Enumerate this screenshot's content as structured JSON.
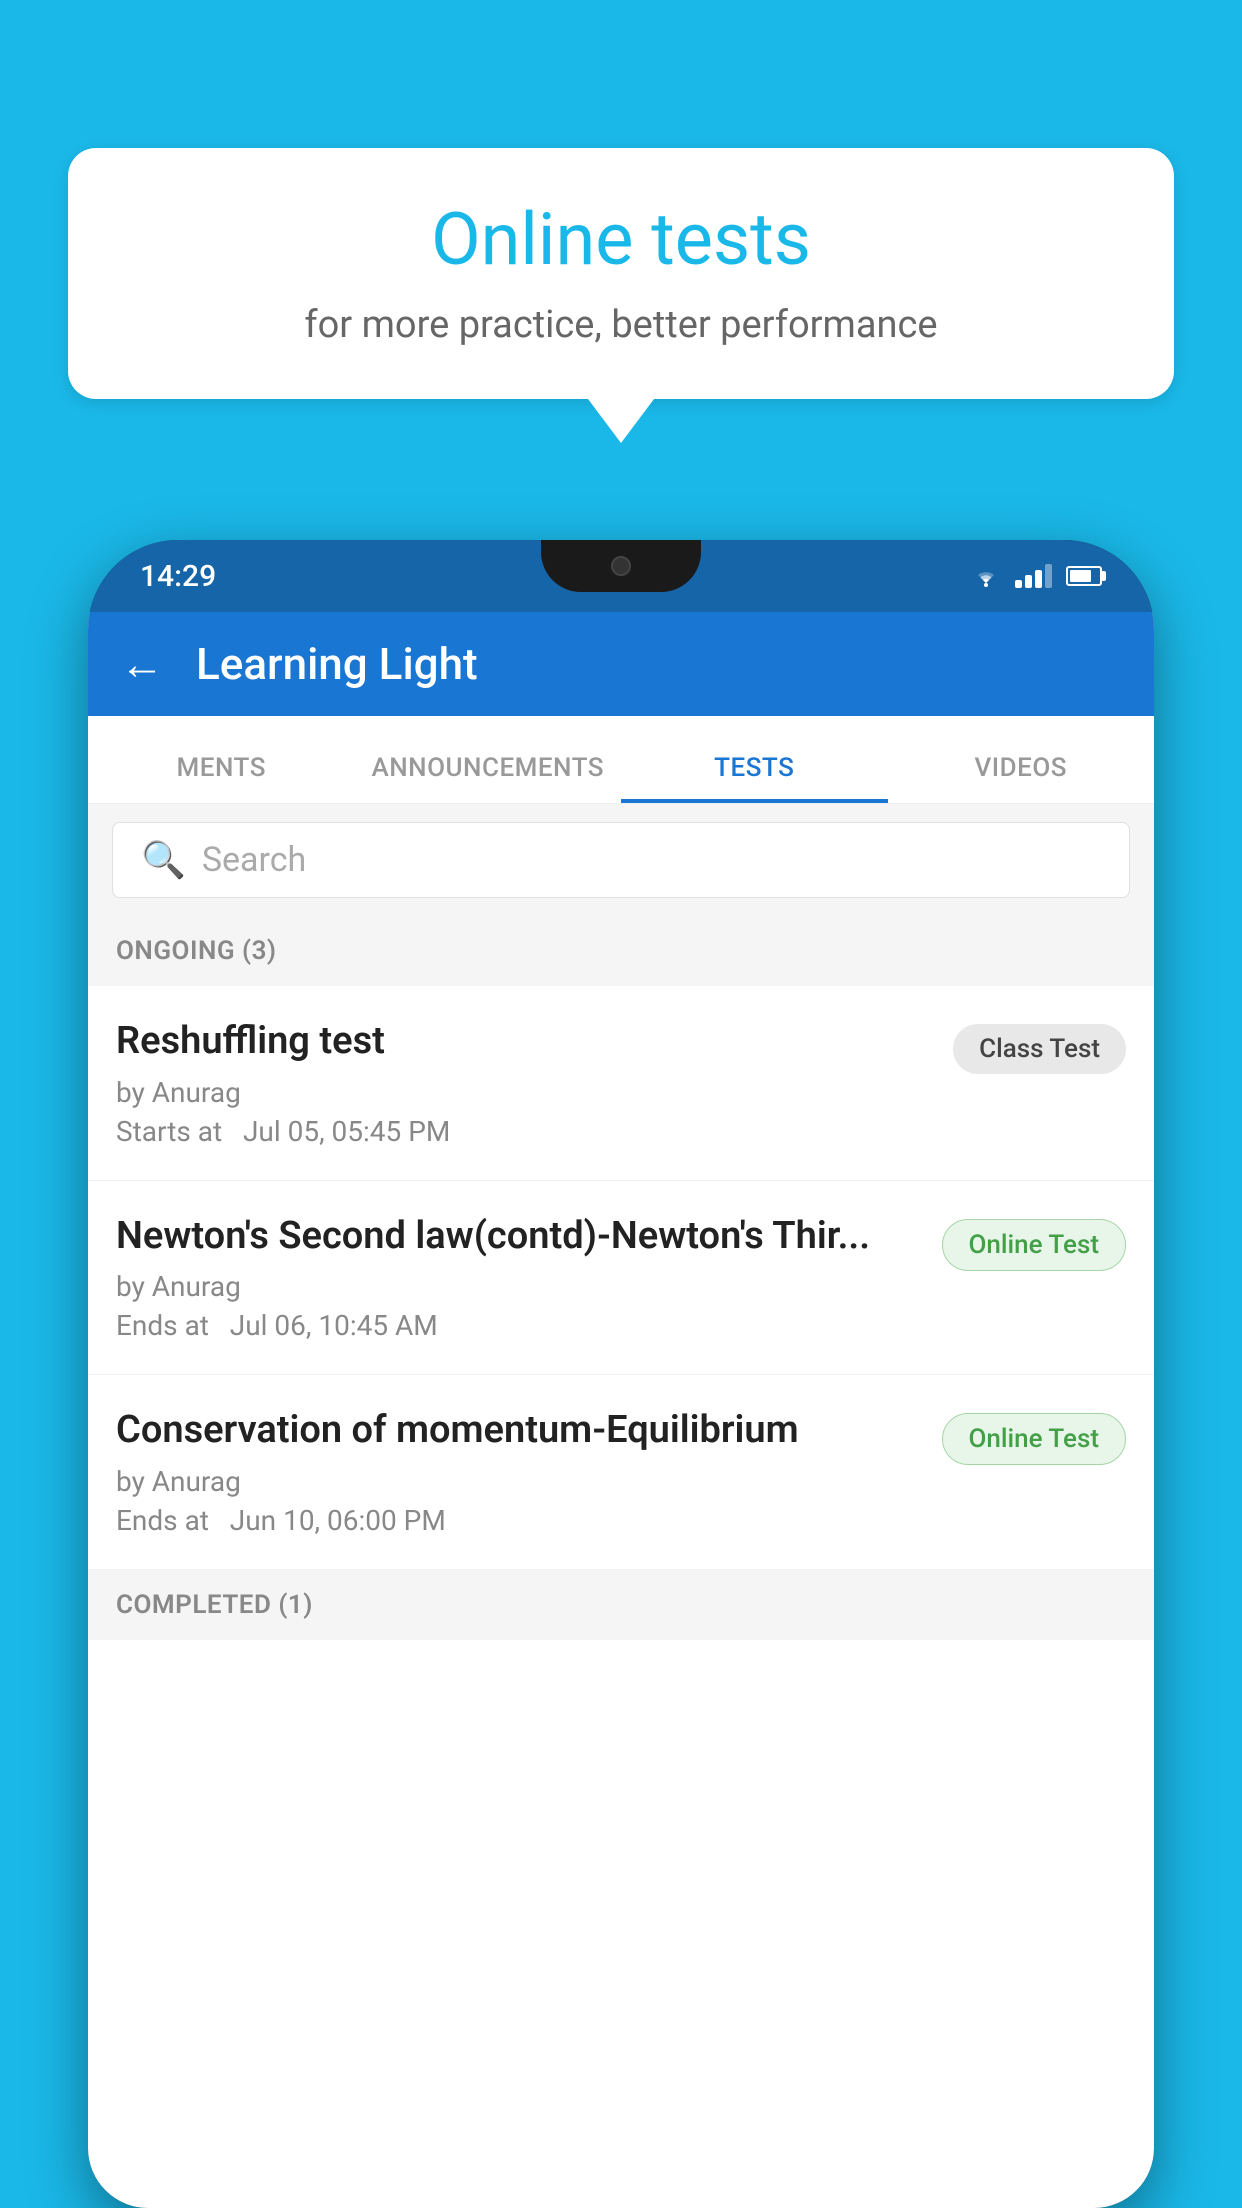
{
  "background_color": "#1ab8e8",
  "bubble": {
    "title": "Online tests",
    "subtitle": "for more practice, better performance"
  },
  "phone": {
    "status_bar": {
      "time": "14:29",
      "icons": [
        "wifi",
        "signal",
        "battery"
      ]
    },
    "app_header": {
      "title": "Learning Light",
      "back_label": "←"
    },
    "tabs": [
      {
        "label": "MENTS",
        "active": false
      },
      {
        "label": "ANNOUNCEMENTS",
        "active": false
      },
      {
        "label": "TESTS",
        "active": true
      },
      {
        "label": "VIDEOS",
        "active": false
      }
    ],
    "search": {
      "placeholder": "Search"
    },
    "ongoing_section": {
      "header": "ONGOING (3)",
      "items": [
        {
          "title": "Reshuffling test",
          "author": "by Anurag",
          "date": "Starts at  Jul 05, 05:45 PM",
          "badge": "Class Test",
          "badge_type": "class"
        },
        {
          "title": "Newton's Second law(contd)-Newton's Thir...",
          "author": "by Anurag",
          "date": "Ends at  Jul 06, 10:45 AM",
          "badge": "Online Test",
          "badge_type": "online"
        },
        {
          "title": "Conservation of momentum-Equilibrium",
          "author": "by Anurag",
          "date": "Ends at  Jun 10, 06:00 PM",
          "badge": "Online Test",
          "badge_type": "online"
        }
      ]
    },
    "completed_section": {
      "header": "COMPLETED (1)"
    }
  }
}
